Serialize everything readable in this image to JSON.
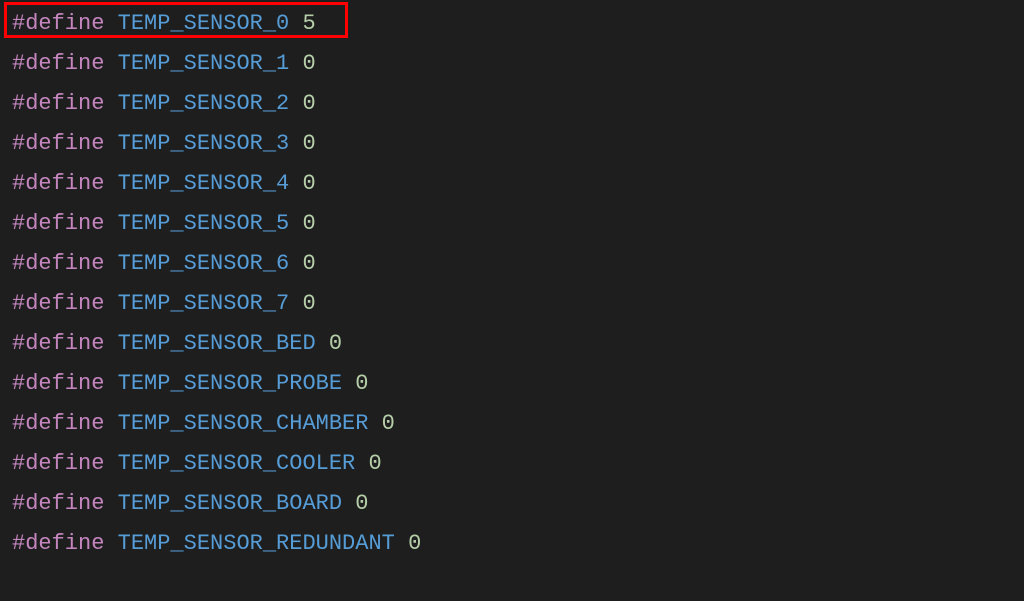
{
  "code": {
    "lines": [
      {
        "directive": "#define",
        "macro": "TEMP_SENSOR_0",
        "value": "5",
        "highlighted": true
      },
      {
        "directive": "#define",
        "macro": "TEMP_SENSOR_1",
        "value": "0",
        "highlighted": false
      },
      {
        "directive": "#define",
        "macro": "TEMP_SENSOR_2",
        "value": "0",
        "highlighted": false
      },
      {
        "directive": "#define",
        "macro": "TEMP_SENSOR_3",
        "value": "0",
        "highlighted": false
      },
      {
        "directive": "#define",
        "macro": "TEMP_SENSOR_4",
        "value": "0",
        "highlighted": false
      },
      {
        "directive": "#define",
        "macro": "TEMP_SENSOR_5",
        "value": "0",
        "highlighted": false
      },
      {
        "directive": "#define",
        "macro": "TEMP_SENSOR_6",
        "value": "0",
        "highlighted": false
      },
      {
        "directive": "#define",
        "macro": "TEMP_SENSOR_7",
        "value": "0",
        "highlighted": false
      },
      {
        "directive": "#define",
        "macro": "TEMP_SENSOR_BED",
        "value": "0",
        "highlighted": false
      },
      {
        "directive": "#define",
        "macro": "TEMP_SENSOR_PROBE",
        "value": "0",
        "highlighted": false
      },
      {
        "directive": "#define",
        "macro": "TEMP_SENSOR_CHAMBER",
        "value": "0",
        "highlighted": false
      },
      {
        "directive": "#define",
        "macro": "TEMP_SENSOR_COOLER",
        "value": "0",
        "highlighted": false
      },
      {
        "directive": "#define",
        "macro": "TEMP_SENSOR_BOARD",
        "value": "0",
        "highlighted": false
      },
      {
        "directive": "#define",
        "macro": "TEMP_SENSOR_REDUNDANT",
        "value": "0",
        "highlighted": false
      }
    ]
  }
}
